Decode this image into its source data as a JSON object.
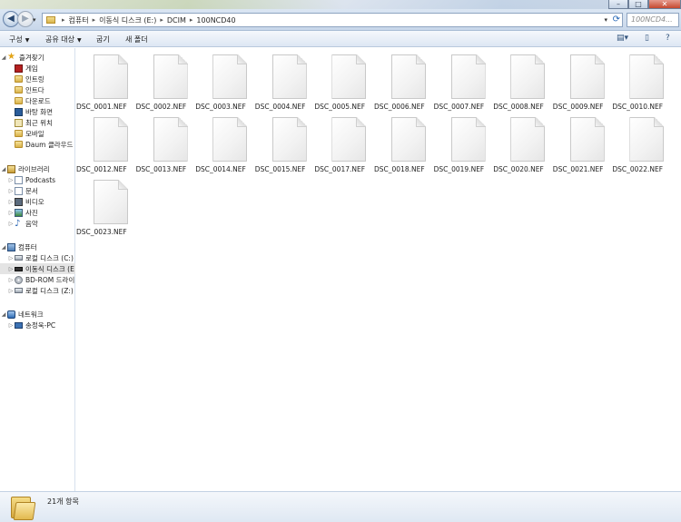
{
  "titlebar": {
    "minimize": "–",
    "maximize": "□",
    "close": "✕"
  },
  "nav": {
    "back": "◀",
    "forward": "▶",
    "dropdown": "▾",
    "breadcrumbs": [
      "컴퓨터",
      "이동식 디스크 (E:)",
      "DCIM",
      "100NCD40"
    ],
    "separator": "▸",
    "search_placeholder": "100NCD4..."
  },
  "command_bar": {
    "organize": "구성",
    "share": "공유 대상",
    "burn": "굽기",
    "new_folder": "새 폴더"
  },
  "sidebar": {
    "favorites": {
      "label": "즐겨찾기",
      "items": [
        "게임",
        "인트링",
        "인트다",
        "다운로드",
        "바탕 화면",
        "최근 위치",
        "모바일",
        "Daum 클라우드"
      ]
    },
    "libraries": {
      "label": "라이브러리",
      "items": [
        "Podcasts",
        "문서",
        "비디오",
        "사진",
        "음악"
      ]
    },
    "computer": {
      "label": "컴퓨터",
      "items": [
        "로컬 디스크 (C:)",
        "이동식 디스크 (E",
        "BD-ROM 드라이",
        "로컬 디스크 (Z:)"
      ]
    },
    "network": {
      "label": "네트워크",
      "items": [
        "송정욱-PC"
      ]
    }
  },
  "files": [
    "DSC_0001.NEF",
    "DSC_0002.NEF",
    "DSC_0003.NEF",
    "DSC_0004.NEF",
    "DSC_0005.NEF",
    "DSC_0006.NEF",
    "DSC_0007.NEF",
    "DSC_0008.NEF",
    "DSC_0009.NEF",
    "DSC_0010.NEF",
    "DSC_0012.NEF",
    "DSC_0013.NEF",
    "DSC_0014.NEF",
    "DSC_0015.NEF",
    "DSC_0017.NEF",
    "DSC_0018.NEF",
    "DSC_0019.NEF",
    "DSC_0020.NEF",
    "DSC_0021.NEF",
    "DSC_0022.NEF",
    "DSC_0023.NEF"
  ],
  "details": {
    "count": "21개 항목"
  }
}
